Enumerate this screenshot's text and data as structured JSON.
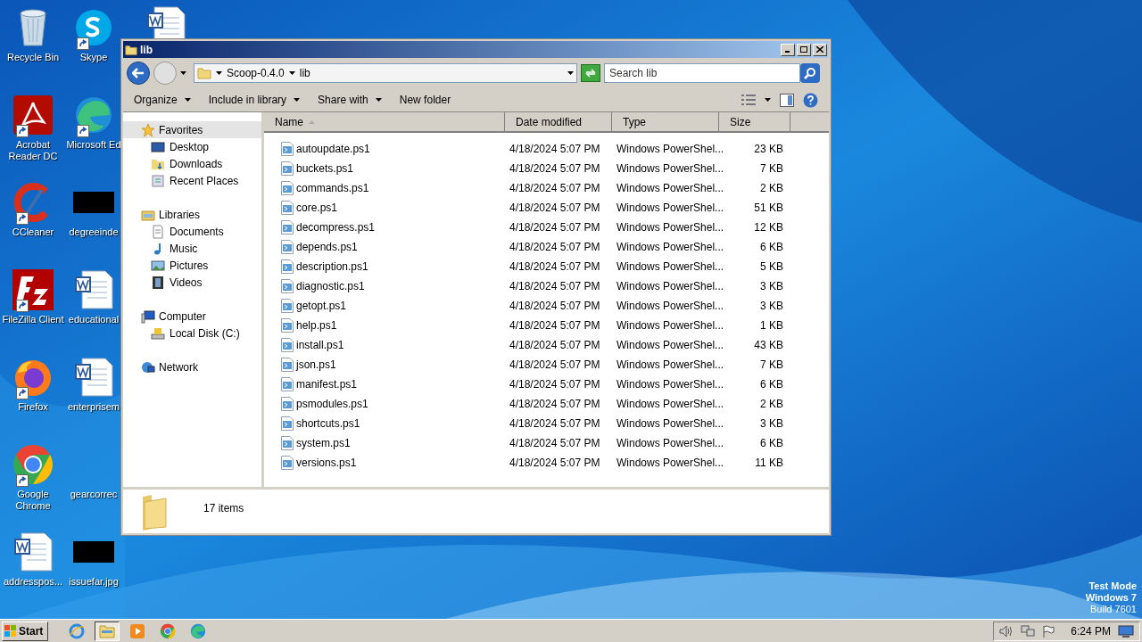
{
  "desktop_icons": [
    {
      "label": "Recycle Bin",
      "kind": "recycle",
      "shortcut": false
    },
    {
      "label": "Acrobat Reader DC",
      "kind": "acrobat",
      "shortcut": true
    },
    {
      "label": "CCleaner",
      "kind": "ccleaner",
      "shortcut": true
    },
    {
      "label": "FileZilla Client",
      "kind": "filezilla",
      "shortcut": true
    },
    {
      "label": "Firefox",
      "kind": "firefox",
      "shortcut": true
    },
    {
      "label": "Google Chrome",
      "kind": "chrome",
      "shortcut": true
    },
    {
      "label": "addresspos...",
      "kind": "word",
      "shortcut": false
    },
    {
      "label": "Skype",
      "kind": "skype",
      "shortcut": true
    },
    {
      "label": "Microsoft Ed",
      "kind": "edge",
      "shortcut": true
    },
    {
      "label": "degreeinde",
      "kind": "redacted",
      "shortcut": false
    },
    {
      "label": "educational",
      "kind": "word",
      "shortcut": false
    },
    {
      "label": "enterprisem",
      "kind": "word",
      "shortcut": false
    },
    {
      "label": "gearcorrec",
      "kind": "blank",
      "shortcut": false
    },
    {
      "label": "issuefar.jpg",
      "kind": "redacted",
      "shortcut": false
    }
  ],
  "window": {
    "title": "lib",
    "breadcrumb": [
      "Scoop-0.4.0",
      "lib"
    ],
    "search": {
      "placeholder": "Search lib"
    },
    "toolbar": [
      {
        "label": "Organize",
        "dropdown": true
      },
      {
        "label": "Include in library",
        "dropdown": true
      },
      {
        "label": "Share with",
        "dropdown": true
      },
      {
        "label": "New folder",
        "dropdown": false
      }
    ],
    "nav": [
      {
        "label": "Favorites",
        "kind": "favorites",
        "selected": true,
        "children": [
          {
            "label": "Desktop",
            "kind": "desktop",
            "selected": false
          },
          {
            "label": "Downloads",
            "kind": "downloads",
            "selected": false
          },
          {
            "label": "Recent Places",
            "kind": "recent",
            "selected": false
          }
        ]
      },
      {
        "label": "Libraries",
        "kind": "libraries",
        "selected": false,
        "children": [
          {
            "label": "Documents",
            "kind": "documents",
            "selected": false
          },
          {
            "label": "Music",
            "kind": "music",
            "selected": false
          },
          {
            "label": "Pictures",
            "kind": "pictures",
            "selected": false
          },
          {
            "label": "Videos",
            "kind": "videos",
            "selected": false
          }
        ]
      },
      {
        "label": "Computer",
        "kind": "computer",
        "selected": false,
        "children": [
          {
            "label": "Local Disk (C:)",
            "kind": "disk",
            "selected": false
          }
        ]
      },
      {
        "label": "Network",
        "kind": "network",
        "selected": false
      }
    ],
    "columns": [
      "Name",
      "Date modified",
      "Type",
      "Size"
    ],
    "files": [
      {
        "name": "autoupdate.ps1",
        "date": "4/18/2024 5:07 PM",
        "type": "Windows PowerShel...",
        "size": "23 KB"
      },
      {
        "name": "buckets.ps1",
        "date": "4/18/2024 5:07 PM",
        "type": "Windows PowerShel...",
        "size": "7 KB"
      },
      {
        "name": "commands.ps1",
        "date": "4/18/2024 5:07 PM",
        "type": "Windows PowerShel...",
        "size": "2 KB"
      },
      {
        "name": "core.ps1",
        "date": "4/18/2024 5:07 PM",
        "type": "Windows PowerShel...",
        "size": "51 KB"
      },
      {
        "name": "decompress.ps1",
        "date": "4/18/2024 5:07 PM",
        "type": "Windows PowerShel...",
        "size": "12 KB"
      },
      {
        "name": "depends.ps1",
        "date": "4/18/2024 5:07 PM",
        "type": "Windows PowerShel...",
        "size": "6 KB"
      },
      {
        "name": "description.ps1",
        "date": "4/18/2024 5:07 PM",
        "type": "Windows PowerShel...",
        "size": "5 KB"
      },
      {
        "name": "diagnostic.ps1",
        "date": "4/18/2024 5:07 PM",
        "type": "Windows PowerShel...",
        "size": "3 KB"
      },
      {
        "name": "getopt.ps1",
        "date": "4/18/2024 5:07 PM",
        "type": "Windows PowerShel...",
        "size": "3 KB"
      },
      {
        "name": "help.ps1",
        "date": "4/18/2024 5:07 PM",
        "type": "Windows PowerShel...",
        "size": "1 KB"
      },
      {
        "name": "install.ps1",
        "date": "4/18/2024 5:07 PM",
        "type": "Windows PowerShel...",
        "size": "43 KB"
      },
      {
        "name": "json.ps1",
        "date": "4/18/2024 5:07 PM",
        "type": "Windows PowerShel...",
        "size": "7 KB"
      },
      {
        "name": "manifest.ps1",
        "date": "4/18/2024 5:07 PM",
        "type": "Windows PowerShel...",
        "size": "6 KB"
      },
      {
        "name": "psmodules.ps1",
        "date": "4/18/2024 5:07 PM",
        "type": "Windows PowerShel...",
        "size": "2 KB"
      },
      {
        "name": "shortcuts.ps1",
        "date": "4/18/2024 5:07 PM",
        "type": "Windows PowerShel...",
        "size": "3 KB"
      },
      {
        "name": "system.ps1",
        "date": "4/18/2024 5:07 PM",
        "type": "Windows PowerShel...",
        "size": "6 KB"
      },
      {
        "name": "versions.ps1",
        "date": "4/18/2024 5:07 PM",
        "type": "Windows PowerShel...",
        "size": "11 KB"
      }
    ],
    "status": "17 items"
  },
  "watermark_lines": [
    "Test Mode",
    "Windows 7",
    "Build 7601"
  ],
  "taskbar": {
    "start": "Start",
    "apps": [
      {
        "kind": "ie",
        "selected": false
      },
      {
        "kind": "explorer",
        "selected": true
      },
      {
        "kind": "media",
        "selected": false
      },
      {
        "kind": "chrome",
        "selected": false
      },
      {
        "kind": "edge",
        "selected": false
      }
    ],
    "clock": "6:24 PM"
  }
}
